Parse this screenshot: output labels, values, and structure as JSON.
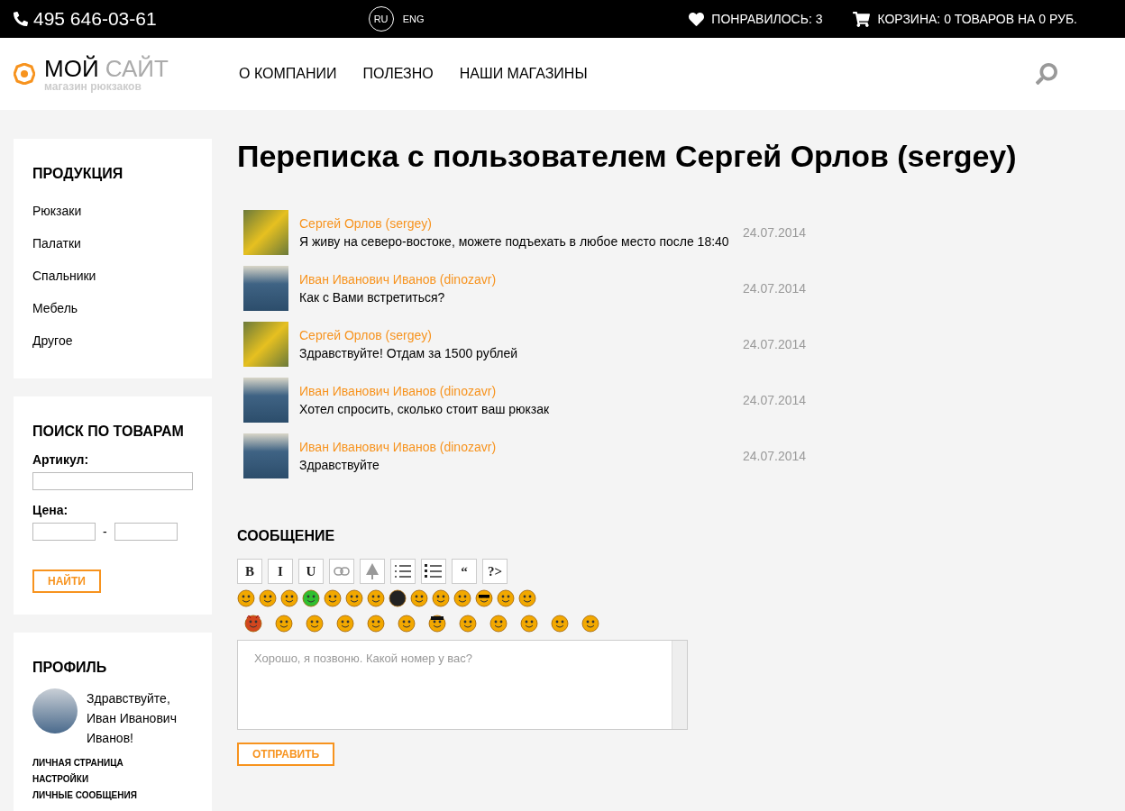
{
  "top_bar": {
    "phone": "495 646-03-61",
    "languages": [
      {
        "label": "RU",
        "selected": true
      },
      {
        "label": "ENG",
        "selected": false
      }
    ],
    "likes": "ПОНРАВИЛОСЬ: 3",
    "cart": "КОРЗИНА: 0 ТОВАРОВ НА 0 РУБ."
  },
  "header": {
    "logo_main": "МОЙ",
    "logo_accent": "САЙТ",
    "logo_tagline": "магазин рюкзаков",
    "nav": [
      "О КОМПАНИИ",
      "ПОЛЕЗНО",
      "НАШИ МАГАЗИНЫ"
    ]
  },
  "sidebar": {
    "products": {
      "title": "ПРОДУКЦИЯ",
      "items": [
        "Рюкзаки",
        "Палатки",
        "Спальники",
        "Мебель",
        "Другое"
      ]
    },
    "search": {
      "title": "ПОИСК ПО ТОВАРАМ",
      "article_label": "Артикул:",
      "price_label": "Цена:",
      "price_separator": "-",
      "button": "НАЙТИ"
    },
    "profile": {
      "title": "ПРОФИЛЬ",
      "greeting": "Здравствуйте, Иван Иванович Иванов!",
      "links": [
        "ЛИЧНАЯ СТРАНИЦА",
        "НАСТРОЙКИ",
        "ЛИЧНЫЕ СООБЩЕНИЯ"
      ]
    }
  },
  "main": {
    "title": "Переписка с пользователем Сергей Орлов (sergey)",
    "messages": [
      {
        "avatar": {
          "kind": "flower"
        },
        "author": "Сергей Орлов (sergey)",
        "text": "Я живу на северо-востоке, можете подъехать в любое место после 18:40",
        "date": "24.07.2014"
      },
      {
        "avatar": {
          "kind": "palm"
        },
        "author": "Иван Иванович Иванов (dinozavr)",
        "text": "Как с Вами встретиться?",
        "date": "24.07.2014"
      },
      {
        "avatar": {
          "kind": "flower"
        },
        "author": "Сергей Орлов (sergey)",
        "text": "Здравствуйте! Отдам за 1500 рублей",
        "date": "24.07.2014"
      },
      {
        "avatar": {
          "kind": "palm"
        },
        "author": "Иван Иванович Иванов (dinozavr)",
        "text": "Хотел спросить, сколько стоит ваш рюкзак",
        "date": "24.07.2014"
      },
      {
        "avatar": {
          "kind": "palm"
        },
        "author": "Иван Иванович Иванов (dinozavr)",
        "text": "Здравствуйте",
        "date": "24.07.2014"
      }
    ],
    "form": {
      "title": "СООБЩЕНИЕ",
      "toolbar": [
        {
          "kind": "text",
          "label": "B"
        },
        {
          "kind": "text",
          "label": "I"
        },
        {
          "kind": "text",
          "label": "U"
        },
        {
          "kind": "link"
        },
        {
          "kind": "tree"
        },
        {
          "kind": "ordered-list"
        },
        {
          "kind": "bullet-list"
        },
        {
          "kind": "text",
          "label": "“"
        },
        {
          "kind": "text",
          "label": "?>"
        }
      ],
      "smiley_rows": [
        [
          {
            "kind": "yellow"
          },
          {
            "kind": "yellow"
          },
          {
            "kind": "yellow"
          },
          {
            "kind": "green"
          },
          {
            "kind": "yellow"
          },
          {
            "kind": "yellow"
          },
          {
            "kind": "yellow"
          },
          {
            "kind": "bomb"
          },
          {
            "kind": "yellow"
          },
          {
            "kind": "yellow"
          },
          {
            "kind": "yellow"
          },
          {
            "kind": "sunglasses"
          },
          {
            "kind": "yellow"
          },
          {
            "kind": "yellow"
          }
        ],
        [
          {
            "kind": "devil"
          },
          {
            "kind": "yellow"
          },
          {
            "kind": "yellow"
          },
          {
            "kind": "yellow"
          },
          {
            "kind": "yellow"
          },
          {
            "kind": "yellow"
          },
          {
            "kind": "hat"
          },
          {
            "kind": "yellow"
          },
          {
            "kind": "yellow"
          },
          {
            "kind": "yellow"
          },
          {
            "kind": "yellow"
          },
          {
            "kind": "yellow"
          }
        ]
      ],
      "placeholder": "Хорошо, я позвоню. Какой номер у вас?",
      "submit": "ОТПРАВИТЬ"
    }
  }
}
